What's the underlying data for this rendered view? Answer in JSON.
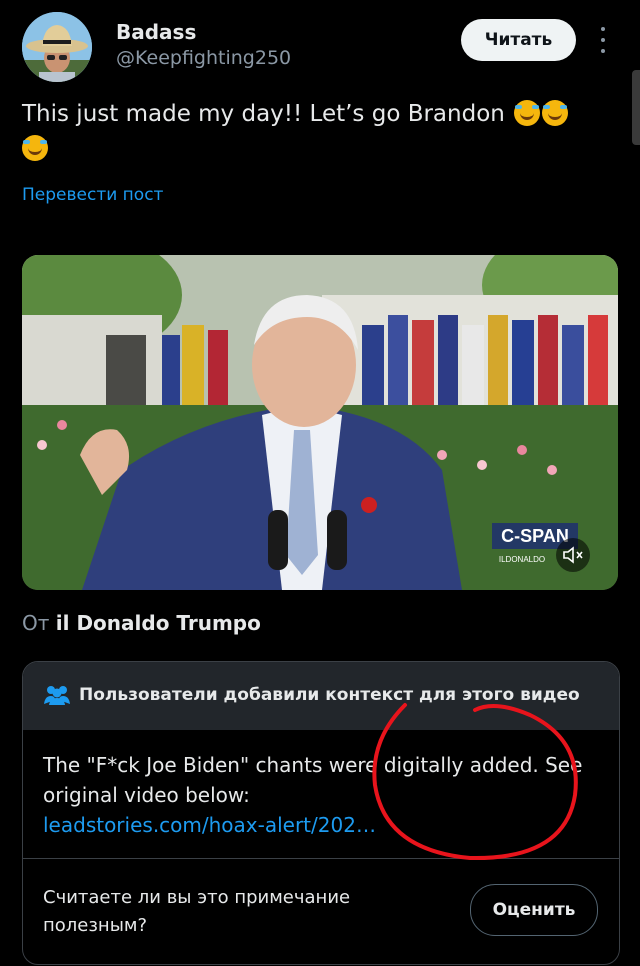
{
  "author": {
    "name": "Badass",
    "handle": "@Keepfighting250",
    "avatar_icon": "avatar-cowboy-hat"
  },
  "header": {
    "follow_label": "Читать",
    "more_icon": "more-vertical-icon"
  },
  "tweet": {
    "text": "This just made my day!! Let’s go Brandon",
    "emoji": "rolling-on-floor-laughing",
    "translate_label": "Перевести пост"
  },
  "media": {
    "watermark": "C-SPAN",
    "watermark_sub": "ILDONALDO",
    "mute_icon": "speaker-muted-icon"
  },
  "source": {
    "prefix": "От",
    "name": "il Donaldo Trumpo"
  },
  "community_note": {
    "title": "Пользователи добавили контекст для этого видео",
    "icon": "people-icon",
    "body": "The \"F*ck Joe Biden\" chants were digitally added.  See original video below:",
    "link": "leadstories.com/hoax-alert/202…",
    "question": "Считаете ли вы это примечание полезным?",
    "rate_label": "Оценить"
  },
  "colors": {
    "background": "#000000",
    "accent_blue": "#1d9bf0",
    "annotation_red": "#e8141c"
  }
}
